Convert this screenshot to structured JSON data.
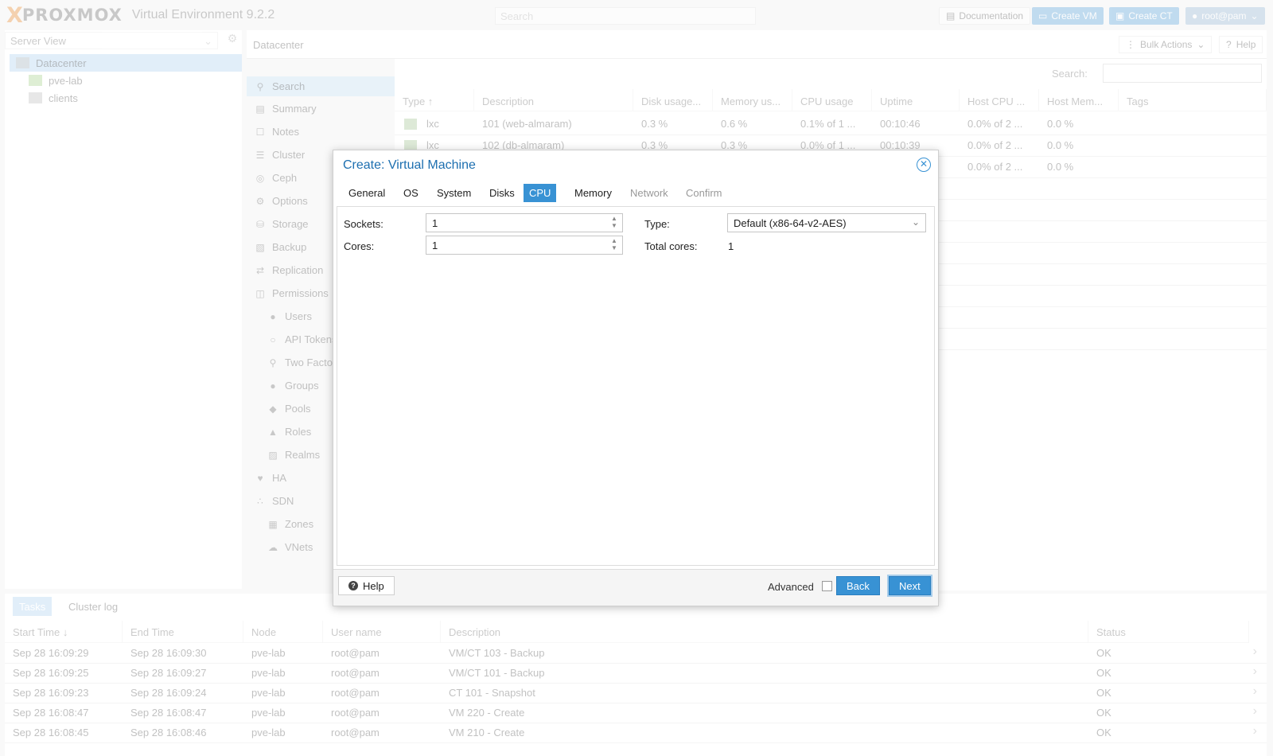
{
  "topbar": {
    "logo_x": "X",
    "logo_word": "PROXMOX",
    "product": "Virtual Environment 9.2.2",
    "search_placeholder": "Search",
    "docs_label": "Documentation",
    "create_vm_label": "Create VM",
    "create_ct_label": "Create CT",
    "user_label": "root@pam"
  },
  "tree": {
    "view_label": "Server View",
    "items": [
      {
        "label": "Datacenter",
        "icon": "datacenter-icon"
      },
      {
        "label": "pve-lab",
        "icon": "node-icon"
      },
      {
        "label": "clients",
        "icon": "tags-icon"
      }
    ]
  },
  "right_header": {
    "title": "Datacenter",
    "bulk_actions": "Bulk Actions",
    "help": "Help"
  },
  "menu": {
    "items": [
      {
        "label": "Search",
        "icon": "search-icon"
      },
      {
        "label": "Summary",
        "icon": "book-icon"
      },
      {
        "label": "Notes",
        "icon": "note-icon"
      },
      {
        "label": "Cluster",
        "icon": "server-icon"
      },
      {
        "label": "Ceph",
        "icon": "ceph-icon"
      },
      {
        "label": "Options",
        "icon": "gear-icon"
      },
      {
        "label": "Storage",
        "icon": "database-icon"
      },
      {
        "label": "Backup",
        "icon": "floppy-icon"
      },
      {
        "label": "Replication",
        "icon": "retweet-icon"
      },
      {
        "label": "Permissions",
        "icon": "unlock-icon"
      },
      {
        "label": "Users",
        "icon": "user-icon"
      },
      {
        "label": "API Tokens",
        "icon": "user-outline-icon"
      },
      {
        "label": "Two Factor",
        "icon": "key-icon"
      },
      {
        "label": "Groups",
        "icon": "users-icon"
      },
      {
        "label": "Pools",
        "icon": "tags-icon"
      },
      {
        "label": "Roles",
        "icon": "male-icon"
      },
      {
        "label": "Realms",
        "icon": "address-book-icon"
      },
      {
        "label": "HA",
        "icon": "heartbeat-icon"
      },
      {
        "label": "SDN",
        "icon": "sdn-icon"
      },
      {
        "label": "Zones",
        "icon": "grid-icon"
      },
      {
        "label": "VNets",
        "icon": "network-icon"
      }
    ]
  },
  "grid": {
    "search_label": "Search:",
    "columns": [
      "Type ↑",
      "Description",
      "Disk usage...",
      "Memory us...",
      "CPU usage",
      "Uptime",
      "Host CPU ...",
      "Host Mem...",
      "Tags"
    ],
    "rows": [
      [
        "lxc",
        "101 (web-almaram)",
        "0.3 %",
        "0.6 %",
        "0.1% of 1 ...",
        "00:10:46",
        "0.0% of 2 ...",
        "0.0 %"
      ],
      [
        "lxc",
        "102 (db-almaram)",
        "0.3 %",
        "0.3 %",
        "0.0% of 1 ...",
        "00:10:39",
        "0.0% of 2 ...",
        "0.0 %"
      ],
      [
        "",
        "",
        "",
        "",
        "",
        "",
        "0.0% of 2 ...",
        "0.0 %"
      ]
    ]
  },
  "tasks": {
    "tabs": [
      "Tasks",
      "Cluster log"
    ],
    "columns": [
      "Start Time ↓",
      "End Time",
      "Node",
      "User name",
      "Description",
      "Status"
    ],
    "rows": [
      [
        "Sep 28 16:09:29",
        "Sep 28 16:09:30",
        "pve-lab",
        "root@pam",
        "VM/CT 103 - Backup",
        "OK"
      ],
      [
        "Sep 28 16:09:25",
        "Sep 28 16:09:27",
        "pve-lab",
        "root@pam",
        "VM/CT 101 - Backup",
        "OK"
      ],
      [
        "Sep 28 16:09:23",
        "Sep 28 16:09:24",
        "pve-lab",
        "root@pam",
        "CT 101 - Snapshot",
        "OK"
      ],
      [
        "Sep 28 16:08:47",
        "Sep 28 16:08:47",
        "pve-lab",
        "root@pam",
        "VM 220 - Create",
        "OK"
      ],
      [
        "Sep 28 16:08:45",
        "Sep 28 16:08:46",
        "pve-lab",
        "root@pam",
        "VM 210 - Create",
        "OK"
      ]
    ]
  },
  "dialog": {
    "title": "Create: Virtual Machine",
    "tabs": [
      "General",
      "OS",
      "System",
      "Disks",
      "CPU",
      "Memory",
      "Network",
      "Confirm"
    ],
    "active_tab": "CPU",
    "sockets_label": "Sockets:",
    "sockets_value": "1",
    "cores_label": "Cores:",
    "cores_value": "1",
    "type_label": "Type:",
    "type_value": "Default (x86-64-v2-AES)",
    "total_cores_label": "Total cores:",
    "total_cores_value": "1",
    "help": "Help",
    "advanced": "Advanced",
    "back": "Back",
    "next": "Next"
  },
  "colors": {
    "accent": "#3892d4",
    "title_blue": "#1d6fb0",
    "logo_orange": "#e57000"
  }
}
